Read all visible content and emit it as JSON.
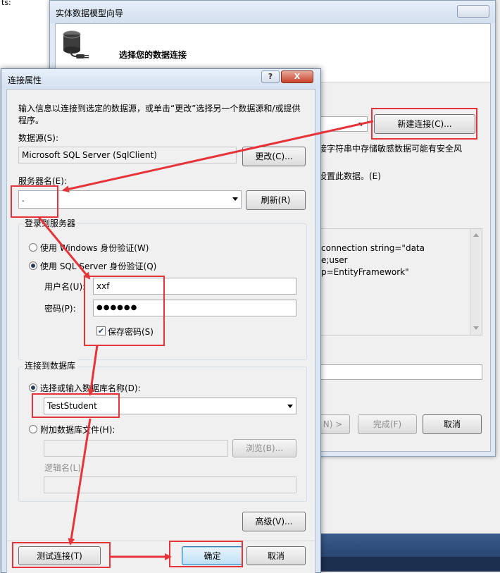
{
  "corner_text": "ts:",
  "wizard": {
    "title": "实体数据模型向导",
    "heading": "选择您的数据连接",
    "new_connection_button": "新建连接(C)...",
    "warning_text": "接字符串中存储敏感数据可能有安全风",
    "warning_text2": "设置此数据。(E)",
    "conn_string_line1": "connection string=\"data",
    "conn_string_line2": "e;user",
    "conn_string_line3": "p=EntityFramework\"",
    "next_button": "N) >",
    "finish_button": "完成(F)",
    "cancel_button": "取消"
  },
  "dialog": {
    "title": "连接属性",
    "help_button": "?",
    "close_button": "X",
    "instructions": "输入信息以连接到选定的数据源，或单击“更改”选择另一个数据源和/或提供程序。",
    "datasource_label": "数据源(S):",
    "datasource_value": "Microsoft SQL Server (SqlClient)",
    "change_button": "更改(C)...",
    "server_label": "服务器名(E):",
    "server_value": ".",
    "refresh_button": "刷新(R)",
    "login_group_title": "登录到服务器",
    "windows_auth_label": "使用 Windows 身份验证(W)",
    "sql_auth_label": "使用 SQL Server 身份验证(Q)",
    "username_label": "用户名(U):",
    "username_value": "xxf",
    "password_label": "密码(P):",
    "password_value": "●●●●●●",
    "save_password_label": "保存密码(S)",
    "db_group_title": "连接到数据库",
    "select_db_label": "选择或输入数据库名称(D):",
    "db_value": "TestStudent",
    "attach_file_label": "附加数据库文件(H):",
    "browse_button": "浏览(B)...",
    "logical_name_label": "逻辑名(L):",
    "advanced_button": "高级(V)...",
    "test_button": "测试连接(T)",
    "ok_button": "确定",
    "cancel_button": "取消"
  },
  "colors": {
    "annotation": "#e5343a",
    "title_bar": "#d4e1f1",
    "taskbar": "#2d4a75"
  }
}
